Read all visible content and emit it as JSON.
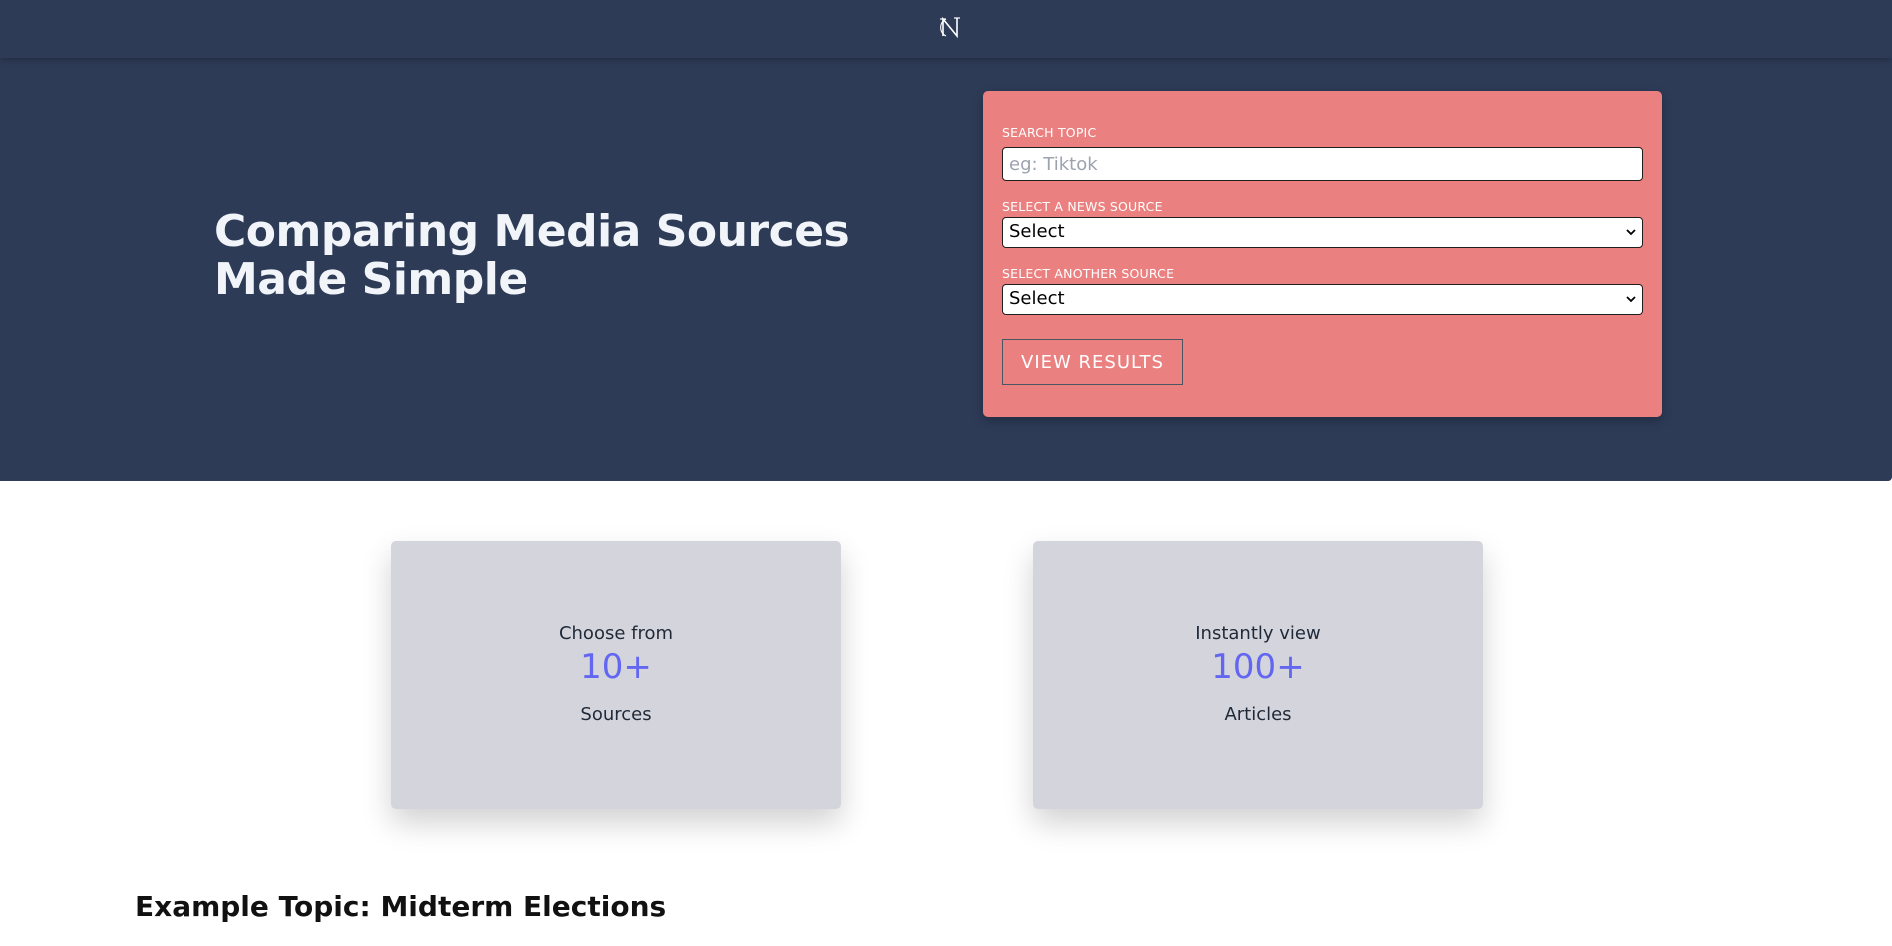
{
  "header": {
    "logo_glyph": "N",
    "logo_icon": "brand-logo-icon"
  },
  "hero": {
    "title": "Comparing Media Sources Made Simple"
  },
  "search_form": {
    "topic_label": "SEARCH TOPIC",
    "topic_placeholder": "eg: Tiktok",
    "topic_value": "",
    "source1_label": "SELECT A NEWS SOURCE",
    "source1_value": "Select",
    "source2_label": "SELECT ANOTHER SOURCE",
    "source2_value": "Select",
    "submit_label": "VIEW RESULTS"
  },
  "stats": [
    {
      "pre": "Choose from",
      "number": "10+",
      "post": "Sources"
    },
    {
      "pre": "Instantly view",
      "number": "100+",
      "post": "Articles"
    }
  ],
  "example": {
    "title": "Example Topic: Midterm Elections"
  },
  "colors": {
    "navy": "#2d3b57",
    "form_bg": "#ea8180",
    "card_bg": "#d4d4dd",
    "accent": "#6366f1"
  }
}
